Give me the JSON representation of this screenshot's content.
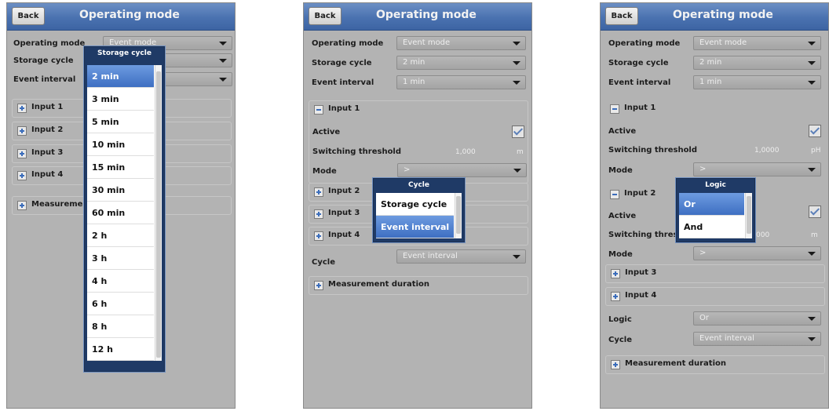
{
  "common": {
    "back_label": "Back",
    "title": "Operating mode",
    "labels": {
      "operating_mode": "Operating mode",
      "storage_cycle": "Storage cycle",
      "event_interval": "Event interval",
      "input1": "Input 1",
      "input2": "Input 2",
      "input3": "Input 3",
      "input4": "Input 4",
      "measurement": "Measurement duration",
      "measurement_clipped": "Measuremen",
      "active": "Active",
      "switching_threshold": "Switching threshold",
      "switching_threshold_clipped": "Switching thresho",
      "mode": "Mode",
      "cycle": "Cycle",
      "logic": "Logic"
    }
  },
  "panel1": {
    "operating_mode_value": "Event mode",
    "popup": {
      "title": "Storage cycle",
      "items": [
        "2 min",
        "3 min",
        "5 min",
        "10 min",
        "15 min",
        "30 min",
        "60 min",
        "2 h",
        "3 h",
        "4 h",
        "6 h",
        "8 h",
        "12 h"
      ],
      "selected_index": 0
    }
  },
  "panel2": {
    "operating_mode_value": "Event mode",
    "storage_cycle_value": "2 min",
    "event_interval_value": "1 min",
    "input1_active": true,
    "threshold_value": "1,000",
    "threshold_unit": "m",
    "mode_value": ">",
    "cycle_value": "Event interval",
    "popup": {
      "title": "Cycle",
      "items": [
        "Storage cycle",
        "Event interval"
      ],
      "selected_index": 1
    }
  },
  "panel3": {
    "operating_mode_value": "Event mode",
    "storage_cycle_value": "2 min",
    "event_interval_value": "1 min",
    "input1_active": true,
    "input1_threshold_value": "1,0000",
    "input1_threshold_unit": "pH",
    "input1_mode_value": ">",
    "input2_active": true,
    "input2_threshold_value": "000",
    "input2_threshold_unit": "m",
    "input2_mode_value": ">",
    "logic_value": "Or",
    "cycle_value": "Event interval",
    "popup": {
      "title": "Logic",
      "items": [
        "Or",
        "And"
      ],
      "selected_index": 0
    }
  }
}
